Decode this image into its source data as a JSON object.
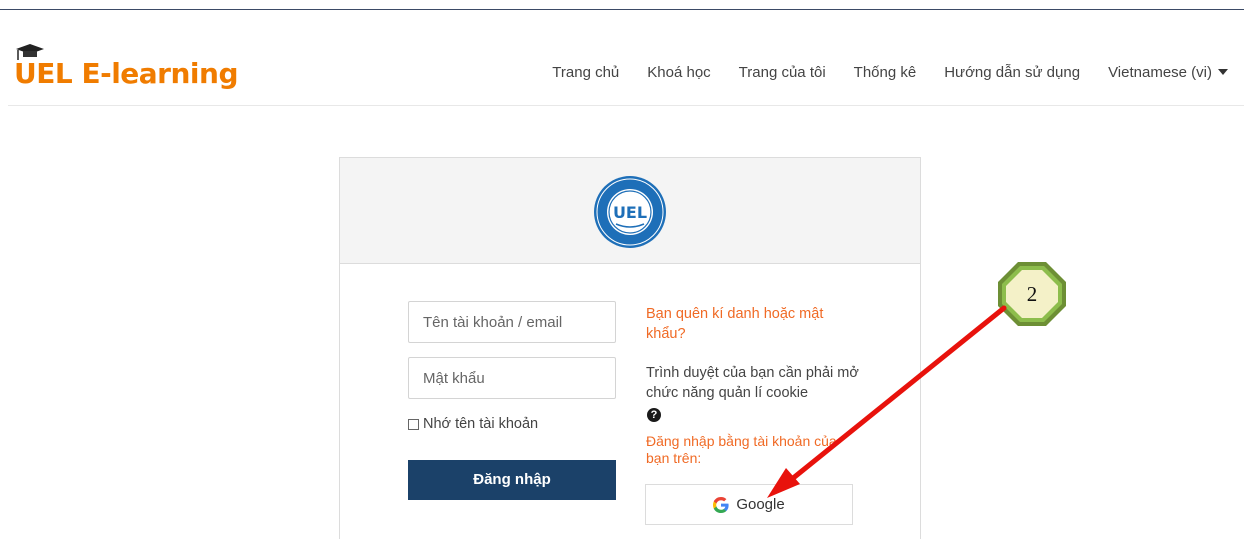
{
  "header": {
    "logo_text": "UEL E-learning",
    "nav": [
      {
        "label": "Trang chủ"
      },
      {
        "label": "Khoá học"
      },
      {
        "label": "Trang của tôi"
      },
      {
        "label": "Thống kê"
      },
      {
        "label": "Hướng dẫn sử dụng"
      },
      {
        "label": "Vietnamese (vi)"
      }
    ]
  },
  "login": {
    "seal_text": "UEL",
    "username_placeholder": "Tên tài khoản / email",
    "password_placeholder": "Mật khẩu",
    "remember_label": "Nhớ tên tài khoản",
    "remember_checked": false,
    "submit_label": "Đăng nhập",
    "forgot_link": "Bạn quên kí danh hoặc mật khẩu?",
    "cookie_note": "Trình duyệt của bạn cần phải mở chức năng quản lí cookie",
    "help_icon": "question-circle-icon",
    "signin_with_text": "Đăng nhập bằng tài khoản của bạn trên:",
    "google_label": "Google"
  },
  "annotation": {
    "step_number": "2",
    "arrow_color": "#e8120c",
    "badge_color": "#7fae3c"
  },
  "colors": {
    "brand_orange": "#f07c00",
    "link_orange": "#f06a25",
    "button_navy": "#1b4169"
  }
}
